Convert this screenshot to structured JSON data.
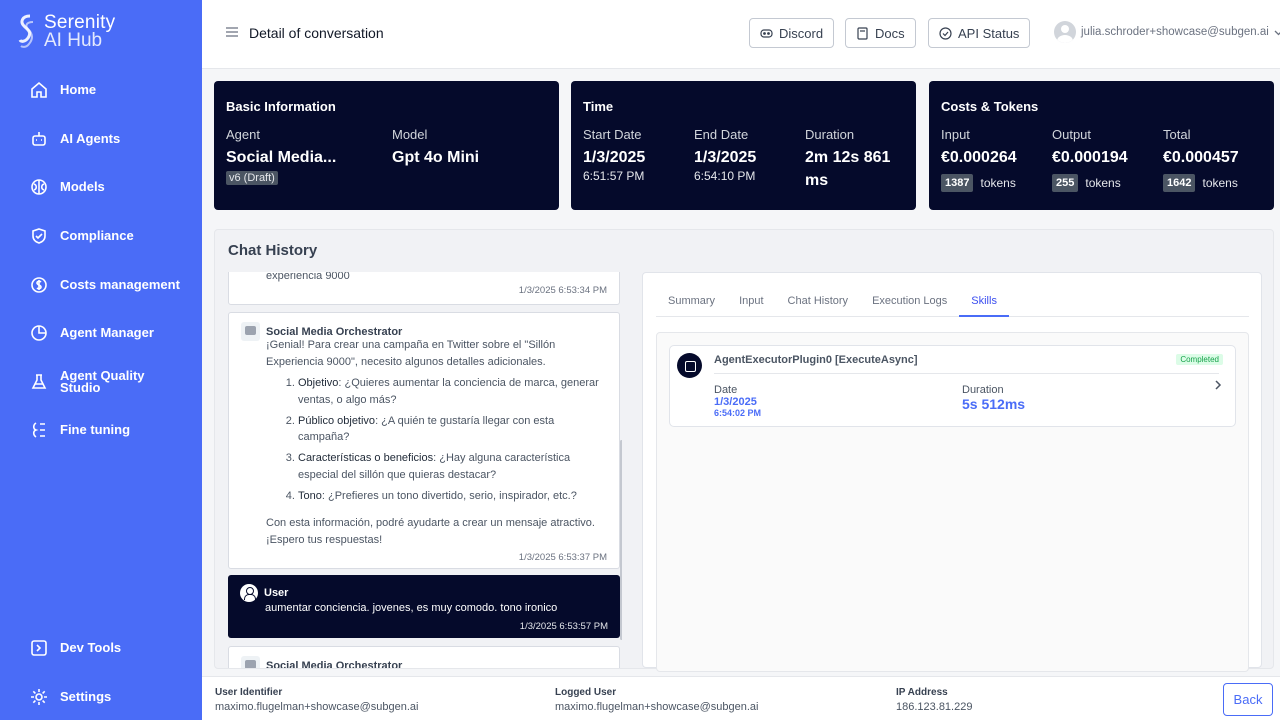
{
  "app": {
    "name": "Serenity",
    "sub": "AI Hub"
  },
  "sidebar": {
    "items": [
      {
        "label": "Home",
        "icon": "home-icon"
      },
      {
        "label": "AI Agents",
        "icon": "robot-icon"
      },
      {
        "label": "Models",
        "icon": "brain-icon"
      },
      {
        "label": "Compliance",
        "icon": "shield-icon"
      },
      {
        "label": "Costs management",
        "icon": "dollar-icon"
      },
      {
        "label": "Agent Manager",
        "icon": "pie-chart-icon"
      },
      {
        "label": "Agent Quality Studio",
        "icon": "flask-icon"
      },
      {
        "label": "Fine tuning",
        "icon": "tuning-icon"
      }
    ],
    "bottom": [
      {
        "label": "Dev Tools",
        "icon": "terminal-icon"
      },
      {
        "label": "Settings",
        "icon": "gear-icon"
      }
    ]
  },
  "header": {
    "title": "Detail of conversation",
    "discord": "Discord",
    "docs": "Docs",
    "api_status": "API Status",
    "user_email": "julia.schroder+showcase@subgen.ai"
  },
  "basic": {
    "title": "Basic Information",
    "agent_label": "Agent",
    "agent_value": "Social Media...",
    "agent_version": "v6 (Draft)",
    "model_label": "Model",
    "model_value": "Gpt 4o Mini"
  },
  "time": {
    "title": "Time",
    "start_label": "Start Date",
    "start_date": "1/3/2025",
    "start_time": "6:51:57 PM",
    "end_label": "End Date",
    "end_date": "1/3/2025",
    "end_time": "6:54:10 PM",
    "duration_label": "Duration",
    "duration_value": "2m 12s 861 ms"
  },
  "costs": {
    "title": "Costs & Tokens",
    "input_label": "Input",
    "input_value": "€0.000264",
    "input_tokens": "1387",
    "output_label": "Output",
    "output_value": "€0.000194",
    "output_tokens": "255",
    "total_label": "Total",
    "total_value": "€0.000457",
    "total_tokens": "1642",
    "tokens_word": "tokens"
  },
  "chat": {
    "title": "Chat History",
    "msg0_text": "experiencia 9000",
    "msg0_time": "1/3/2025 6:53:34 PM",
    "msg1_sender": "Social Media Orchestrator",
    "msg1_intro": "¡Genial! Para crear una campaña en Twitter sobre el \"Sillón Experiencia 9000\", necesito algunos detalles adicionales.",
    "msg1_items": [
      {
        "key": "Objetivo",
        "text": ": ¿Quieres aumentar la conciencia de marca, generar ventas, o algo más?"
      },
      {
        "key": "Público objetivo",
        "text": ": ¿A quién te gustaría llegar con esta campaña?"
      },
      {
        "key": "Características o beneficios",
        "text": ": ¿Hay alguna característica especial del sillón que quieras destacar?"
      },
      {
        "key": "Tono",
        "text": ": ¿Prefieres un tono divertido, serio, inspirador, etc.?"
      }
    ],
    "msg1_outro": "Con esta información, podré ayudarte a crear un mensaje atractivo. ¡Espero tus respuestas!",
    "msg1_time": "1/3/2025 6:53:37 PM",
    "msg2_sender": "User",
    "msg2_text": "aumentar conciencia. jovenes, es muy comodo. tono ironico",
    "msg2_time": "1/3/2025 6:53:57 PM",
    "msg3_sender": "Social Media Orchestrator"
  },
  "detail": {
    "tabs": [
      "Summary",
      "Input",
      "Chat History",
      "Execution Logs",
      "Skills"
    ],
    "active_tab": "Skills",
    "skill_name": "AgentExecutorPlugin0 [ExecuteAsync]",
    "skill_status": "Completed",
    "date_label": "Date",
    "date_value": "1/3/2025",
    "date_time": "6:54:02 PM",
    "duration_label": "Duration",
    "duration_value": "5s 512ms"
  },
  "footer": {
    "user_id_label": "User Identifier",
    "user_id_value": "maximo.flugelman+showcase@subgen.ai",
    "logged_label": "Logged User",
    "logged_value": "maximo.flugelman+showcase@subgen.ai",
    "ip_label": "IP Address",
    "ip_value": "186.123.81.229",
    "back": "Back"
  },
  "colors": {
    "brand": "#4a6cf7",
    "navy": "#050a2b"
  }
}
